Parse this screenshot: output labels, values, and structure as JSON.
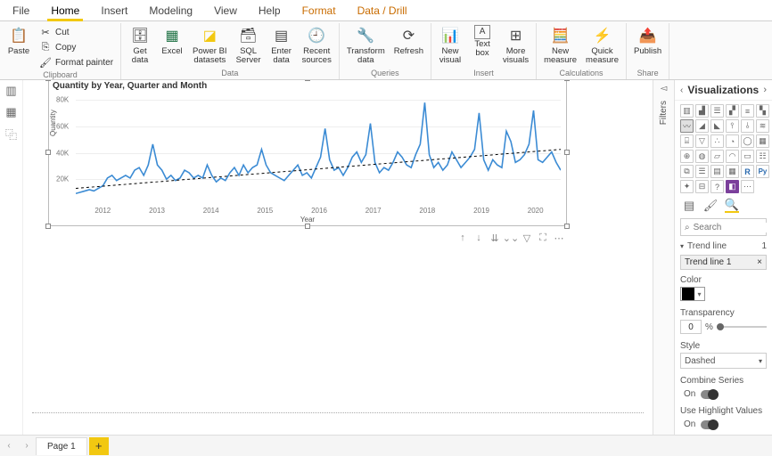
{
  "tabs": [
    "File",
    "Home",
    "Insert",
    "Modeling",
    "View",
    "Help",
    "Format",
    "Data / Drill"
  ],
  "ribbon": {
    "clipboard": {
      "paste": "Paste",
      "cut": "Cut",
      "copy": "Copy",
      "format_painter": "Format painter",
      "group": "Clipboard"
    },
    "data": {
      "get_data": "Get\ndata",
      "excel": "Excel",
      "pbi_ds": "Power BI\ndatasets",
      "sql": "SQL\nServer",
      "enter": "Enter\ndata",
      "recent": "Recent\nsources",
      "group": "Data"
    },
    "queries": {
      "transform": "Transform\ndata",
      "refresh": "Refresh",
      "group": "Queries"
    },
    "insert": {
      "new_visual": "New\nvisual",
      "text_box": "Text\nbox",
      "more": "More\nvisuals",
      "group": "Insert"
    },
    "calc": {
      "new_measure": "New\nmeasure",
      "quick": "Quick\nmeasure",
      "group": "Calculations"
    },
    "share": {
      "publish": "Publish",
      "group": "Share"
    }
  },
  "visual": {
    "title": "Quantity by Year, Quarter and Month",
    "ylabel": "Quantity",
    "xlabel": "Year",
    "yticks": [
      "20K",
      "40K",
      "60K",
      "80K"
    ],
    "xticks": [
      "2012",
      "2013",
      "2014",
      "2015",
      "2016",
      "2017",
      "2018",
      "2019",
      "2020"
    ]
  },
  "chart_data": {
    "type": "line",
    "title": "Quantity by Year, Quarter and Month",
    "xlabel": "Year",
    "ylabel": "Quantity",
    "ylim": [
      0,
      85000
    ],
    "x_domain": [
      "2011-07",
      "2020-06"
    ],
    "trend": {
      "style": "dashed",
      "start_y": 12000,
      "end_y": 42000
    },
    "series": [
      {
        "name": "Quantity",
        "color": "#3b8bd4",
        "x": [
          "2011-07",
          "2011-08",
          "2011-09",
          "2011-10",
          "2011-11",
          "2011-12",
          "2012-01",
          "2012-02",
          "2012-03",
          "2012-04",
          "2012-05",
          "2012-06",
          "2012-07",
          "2012-08",
          "2012-09",
          "2012-10",
          "2012-11",
          "2012-12",
          "2013-01",
          "2013-02",
          "2013-03",
          "2013-04",
          "2013-05",
          "2013-06",
          "2013-07",
          "2013-08",
          "2013-09",
          "2013-10",
          "2013-11",
          "2013-12",
          "2014-01",
          "2014-02",
          "2014-03",
          "2014-04",
          "2014-05",
          "2014-06",
          "2014-07",
          "2014-08",
          "2014-09",
          "2014-10",
          "2014-11",
          "2014-12",
          "2015-01",
          "2015-02",
          "2015-03",
          "2015-04",
          "2015-05",
          "2015-06",
          "2015-07",
          "2015-08",
          "2015-09",
          "2015-10",
          "2015-11",
          "2015-12",
          "2016-01",
          "2016-02",
          "2016-03",
          "2016-04",
          "2016-05",
          "2016-06",
          "2016-07",
          "2016-08",
          "2016-09",
          "2016-10",
          "2016-11",
          "2016-12",
          "2017-01",
          "2017-02",
          "2017-03",
          "2017-04",
          "2017-05",
          "2017-06",
          "2017-07",
          "2017-08",
          "2017-09",
          "2017-10",
          "2017-11",
          "2017-12",
          "2018-01",
          "2018-02",
          "2018-03",
          "2018-04",
          "2018-05",
          "2018-06",
          "2018-07",
          "2018-08",
          "2018-09",
          "2018-10",
          "2018-11",
          "2018-12",
          "2019-01",
          "2019-02",
          "2019-03",
          "2019-04",
          "2019-05",
          "2019-06",
          "2019-07",
          "2019-08",
          "2019-09",
          "2019-10",
          "2019-11",
          "2019-12",
          "2020-01",
          "2020-02",
          "2020-03",
          "2020-04",
          "2020-05",
          "2020-06"
        ],
        "y": [
          8000,
          9000,
          10000,
          11000,
          10000,
          12000,
          14000,
          20000,
          22000,
          18000,
          20000,
          22000,
          20000,
          26000,
          28000,
          22000,
          30000,
          46000,
          30000,
          26000,
          19000,
          22000,
          18000,
          20000,
          26000,
          24000,
          20000,
          22000,
          20000,
          30000,
          22000,
          17000,
          20000,
          18000,
          24000,
          28000,
          22000,
          30000,
          24000,
          28000,
          30000,
          42000,
          30000,
          24000,
          22000,
          20000,
          18000,
          22000,
          26000,
          30000,
          22000,
          24000,
          20000,
          28000,
          36000,
          58000,
          34000,
          26000,
          28000,
          22000,
          28000,
          36000,
          40000,
          32000,
          38000,
          62000,
          32000,
          24000,
          28000,
          26000,
          32000,
          40000,
          36000,
          30000,
          28000,
          38000,
          46000,
          78000,
          38000,
          28000,
          32000,
          26000,
          30000,
          40000,
          34000,
          28000,
          32000,
          36000,
          42000,
          70000,
          34000,
          26000,
          34000,
          30000,
          28000,
          56000,
          48000,
          32000,
          34000,
          38000,
          46000,
          72000,
          34000,
          32000,
          36000,
          40000,
          32000,
          26000
        ]
      }
    ]
  },
  "panel": {
    "title": "Visualizations",
    "filters": "Filters",
    "search_ph": "Search",
    "trend_section": "Trend line",
    "trend_count": "1",
    "trend_item": "Trend line 1",
    "color_label": "Color",
    "transparency_label": "Transparency",
    "trans_value": "0",
    "pct": "%",
    "style_label": "Style",
    "style_value": "Dashed",
    "combine_label": "Combine Series",
    "on": "On",
    "highlight_label": "Use Highlight Values"
  },
  "page": {
    "tab": "Page 1"
  }
}
